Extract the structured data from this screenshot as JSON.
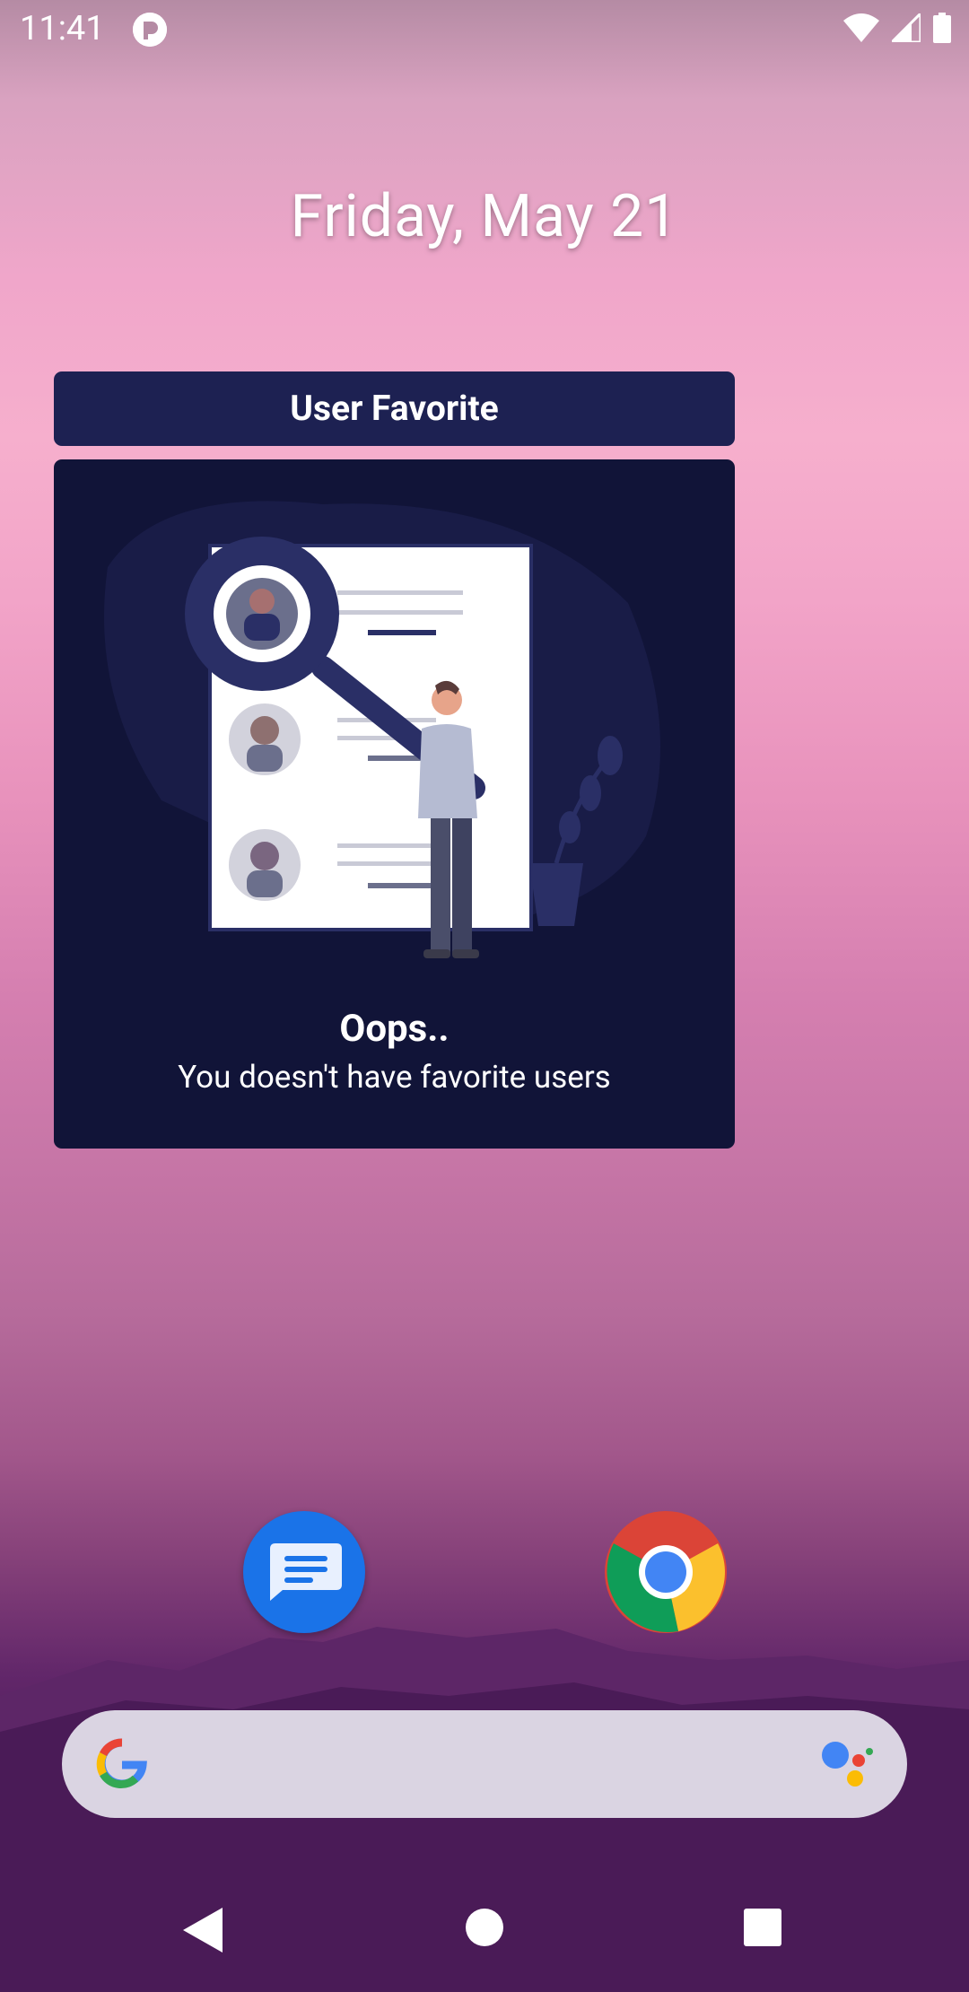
{
  "status_bar": {
    "time": "11:41"
  },
  "home": {
    "date": "Friday, May 21"
  },
  "widget": {
    "title": "User Favorite",
    "empty_title": "Oops..",
    "empty_message": "You doesn't have favorite users"
  },
  "apps": [
    {
      "name": "Messages",
      "icon": "messages-icon"
    },
    {
      "name": "Chrome",
      "icon": "chrome-icon"
    }
  ],
  "search_bar": {
    "icon": "google-g-icon",
    "assistant_icon": "google-assistant-icon"
  },
  "nav": {
    "back": "back-icon",
    "home": "home-icon",
    "recents": "recents-icon"
  },
  "colors": {
    "widget_header": "#1d2152",
    "widget_body": "#111438",
    "messages_blue": "#1a73e8"
  }
}
